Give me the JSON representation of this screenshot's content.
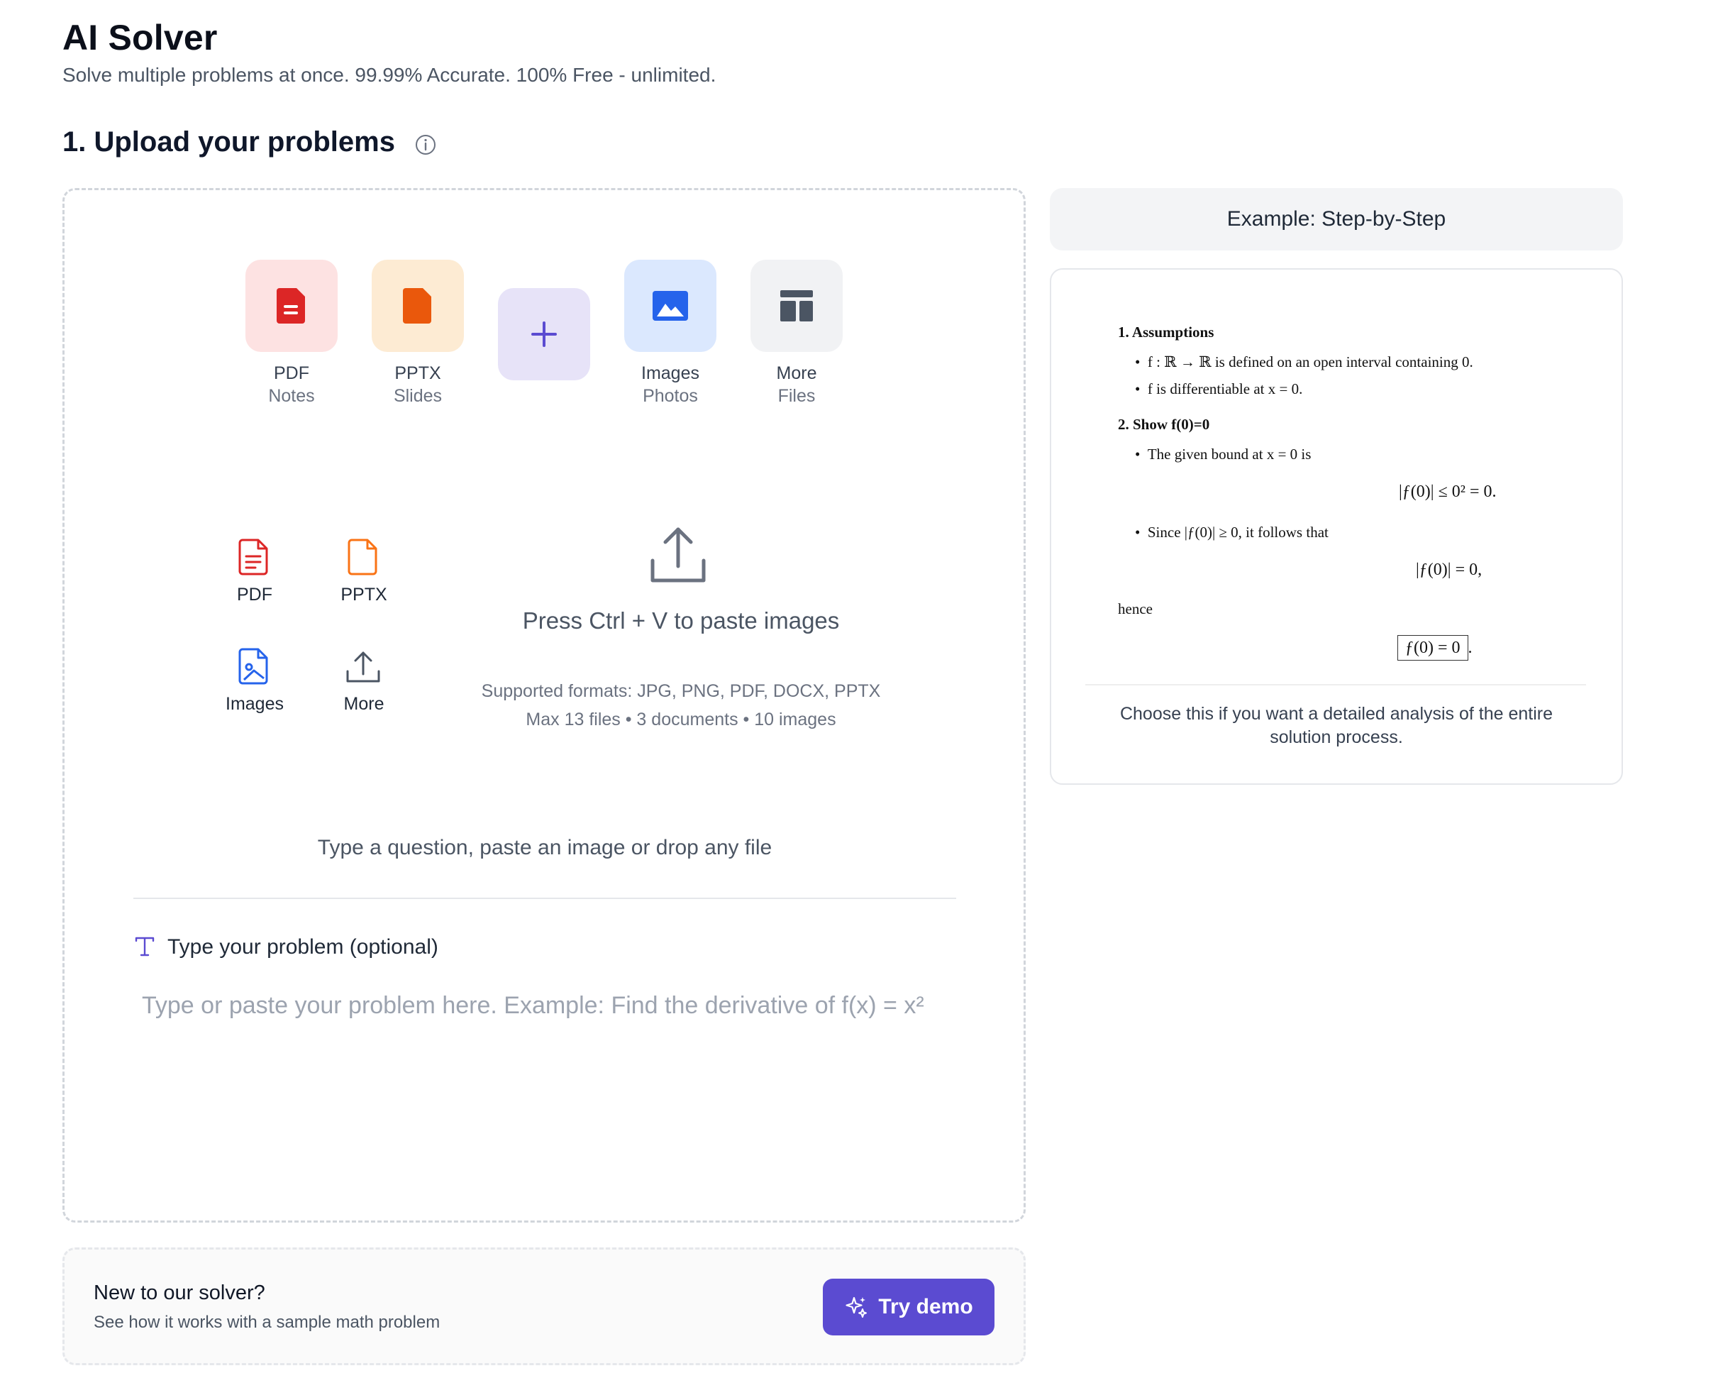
{
  "header": {
    "title": "AI Solver",
    "subtitle": "Solve multiple problems at once. 99.99% Accurate. 100% Free - unlimited."
  },
  "section": {
    "title": "1. Upload your problems",
    "info_icon": "info-circle-icon"
  },
  "upload": {
    "tiles": [
      {
        "label": "PDF",
        "sub": "Notes",
        "icon": "pdf-file-icon",
        "bg": "#fde2e2",
        "color": "#dc2626"
      },
      {
        "label": "PPTX",
        "sub": "Slides",
        "icon": "pptx-file-icon",
        "bg": "#fdebd3",
        "color": "#ea580c"
      },
      {
        "label": "",
        "sub": "",
        "icon": "plus-icon",
        "bg": "#e7e3f8",
        "color": "#5b4bd1"
      },
      {
        "label": "Images",
        "sub": "Photos",
        "icon": "image-icon",
        "bg": "#dbe8fe",
        "color": "#2563eb"
      },
      {
        "label": "More",
        "sub": "Files",
        "icon": "layout-icon",
        "bg": "#f1f2f4",
        "color": "#4b5563"
      }
    ],
    "formats": [
      {
        "label": "PDF",
        "icon": "pdf-outline-icon"
      },
      {
        "label": "PPTX",
        "icon": "pptx-outline-icon"
      },
      {
        "label": "Images",
        "icon": "image-file-outline-icon"
      },
      {
        "label": "More",
        "icon": "upload-outline-icon"
      }
    ],
    "paste_text": "Press Ctrl + V to paste images",
    "supported_formats": "Supported formats: JPG, PNG, PDF, DOCX, PPTX",
    "limits": "Max 13 files • 3 documents • 10 images",
    "drop_hint": "Type a question, paste an image or drop any file",
    "type_label": "Type your problem (optional)",
    "input_placeholder": "Type or paste your problem here. Example: Find the derivative of f(x) = x²",
    "input_value": ""
  },
  "demo": {
    "title": "New to our solver?",
    "subtitle": "See how it works with a sample math problem",
    "button_label": "Try demo"
  },
  "example": {
    "tab_label": "Example: Step-by-Step",
    "heading1": "1. Assumptions",
    "bullet1": "f : ℝ → ℝ is defined on an open interval containing 0.",
    "bullet2": "f is differentiable at x = 0.",
    "heading2": "2. Show f(0)=0",
    "bullet3": "The given bound at x = 0 is",
    "eq1": "|ƒ(0)| ≤ 0² = 0.",
    "bullet4": "Since |ƒ(0)| ≥ 0, it follows that",
    "eq2": "|ƒ(0)| = 0,",
    "hence": "hence",
    "eq3": "ƒ(0) = 0",
    "eq3_suffix": ".",
    "caption": "Choose this if you want a detailed analysis of the entire solution process."
  },
  "colors": {
    "accent": "#5b4bd1",
    "title": "#0b0f1a",
    "muted": "#6b7280"
  }
}
